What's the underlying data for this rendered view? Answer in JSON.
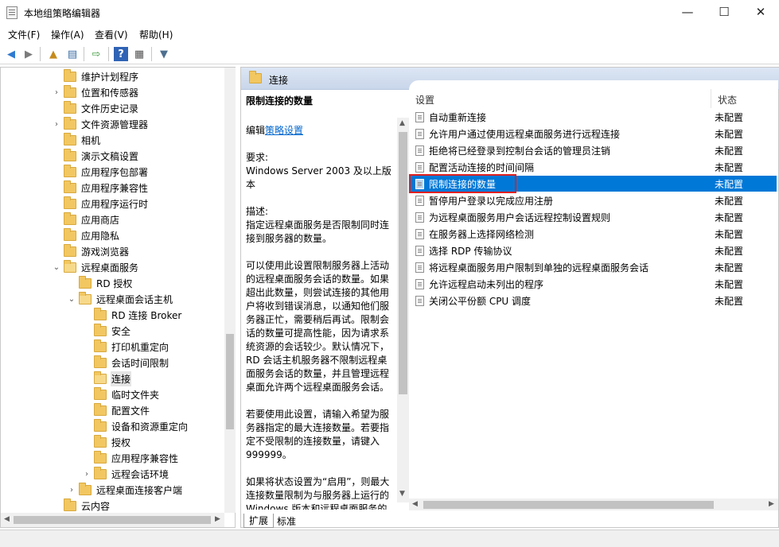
{
  "window": {
    "title": "本地组策略编辑器",
    "minimize": "—",
    "maximize": "☐",
    "close": "✕"
  },
  "menu": [
    "文件(F)",
    "操作(A)",
    "查看(V)",
    "帮助(H)"
  ],
  "toolbar": {
    "back": "◀",
    "forward": "▶",
    "up": "▲",
    "show_hide": "▤",
    "export": "⇨",
    "help": "?",
    "properties": "▦",
    "filter": "▼"
  },
  "tree": {
    "items": [
      {
        "label": "维护计划程序",
        "expandable": false
      },
      {
        "label": "位置和传感器",
        "expandable": true
      },
      {
        "label": "文件历史记录",
        "expandable": false
      },
      {
        "label": "文件资源管理器",
        "expandable": true
      },
      {
        "label": "相机",
        "expandable": false
      },
      {
        "label": "演示文稿设置",
        "expandable": false
      },
      {
        "label": "应用程序包部署",
        "expandable": false
      },
      {
        "label": "应用程序兼容性",
        "expandable": false
      },
      {
        "label": "应用程序运行时",
        "expandable": false
      },
      {
        "label": "应用商店",
        "expandable": false
      },
      {
        "label": "应用隐私",
        "expandable": false
      },
      {
        "label": "游戏浏览器",
        "expandable": false
      },
      {
        "label": "远程桌面服务",
        "expanded": true
      },
      {
        "label": "RD 授权",
        "expandable": false
      },
      {
        "label": "远程桌面会话主机",
        "expanded": true
      },
      {
        "label": "RD 连接 Broker",
        "expandable": false
      },
      {
        "label": "安全",
        "expandable": false
      },
      {
        "label": "打印机重定向",
        "expandable": false
      },
      {
        "label": "会话时间限制",
        "expandable": false
      },
      {
        "label": "连接",
        "selected": true
      },
      {
        "label": "临时文件夹",
        "expandable": false
      },
      {
        "label": "配置文件",
        "expandable": false
      },
      {
        "label": "设备和资源重定向",
        "expandable": false
      },
      {
        "label": "授权",
        "expandable": false
      },
      {
        "label": "应用程序兼容性",
        "expandable": false
      },
      {
        "label": "远程会话环境",
        "expandable": true
      },
      {
        "label": "远程桌面连接客户端",
        "expandable": true
      },
      {
        "label": "云内容",
        "expandable": false
      }
    ]
  },
  "right": {
    "header_title": "连接",
    "description": {
      "title": "限制连接的数量",
      "edit_prefix": "编辑",
      "edit_link": "策略设置",
      "requirement_label": "要求:",
      "requirement_text": "Windows Server 2003 及以上版本",
      "desc_label": "描述:",
      "desc_text": "指定远程桌面服务是否限制同时连接到服务器的数量。",
      "para1": "可以使用此设置限制服务器上活动的远程桌面服务会话的数量。如果超出此数量，则尝试连接的其他用户将收到错误消息，以通知他们服务器正忙，需要稍后再试。限制会话的数量可提高性能，因为请求系统资源的会话较少。默认情况下，RD 会话主机服务器不限制远程桌面服务会话的数量，并且管理远程桌面允许两个远程桌面服务会话。",
      "para2": "若要使用此设置，请输入希望为服务器指定的最大连接数量。若要指定不受限制的连接数量，请键入 999999。",
      "para3": "如果将状态设置为“启用”，则最大连接数量限制为与服务器上运行的 Windows 版本和远程桌面服务的"
    },
    "columns": {
      "setting": "设置",
      "state": "状态"
    },
    "rows": [
      {
        "name": "自动重新连接",
        "state": "未配置"
      },
      {
        "name": "允许用户通过使用远程桌面服务进行远程连接",
        "state": "未配置"
      },
      {
        "name": "拒绝将已经登录到控制台会话的管理员注销",
        "state": "未配置"
      },
      {
        "name": "配置活动连接的时间间隔",
        "state": "未配置"
      },
      {
        "name": "限制连接的数量",
        "state": "未配置",
        "selected": true
      },
      {
        "name": "暂停用户登录以完成应用注册",
        "state": "未配置"
      },
      {
        "name": "为远程桌面服务用户会话远程控制设置规则",
        "state": "未配置"
      },
      {
        "name": "在服务器上选择网络检测",
        "state": "未配置"
      },
      {
        "name": "选择 RDP 传输协议",
        "state": "未配置"
      },
      {
        "name": "将远程桌面服务用户限制到单独的远程桌面服务会话",
        "state": "未配置"
      },
      {
        "name": "允许远程启动未列出的程序",
        "state": "未配置"
      },
      {
        "name": "关闭公平份额 CPU 调度",
        "state": "未配置"
      }
    ]
  },
  "tabs": [
    "扩展",
    "标准"
  ],
  "colors": {
    "selection": "#0078d7",
    "highlight_box": "#e02020",
    "header_gradient_top": "#dce6f4"
  }
}
